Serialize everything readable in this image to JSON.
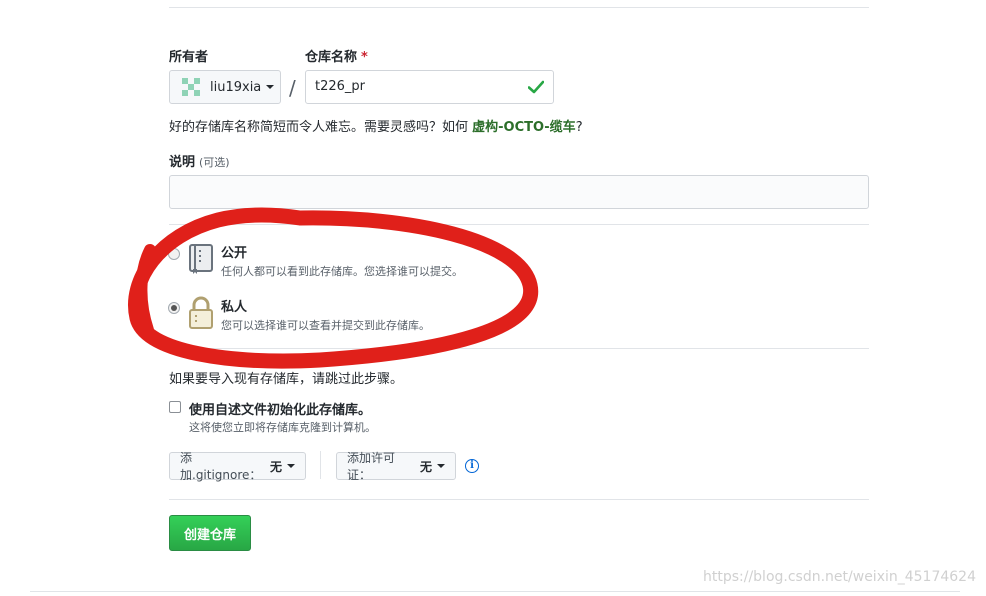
{
  "owner": {
    "label": "所有者",
    "username": "liu19xia"
  },
  "repo": {
    "label": "仓库名称",
    "required_mark": "*",
    "value": "t226_pr",
    "slash": "/"
  },
  "hint": {
    "prefix": "好的存储库名称简短而令人难忘。需要灵感吗？如何 ",
    "suggestion": "虚构-OCTO-缆车",
    "suffix": "?"
  },
  "description": {
    "label": "说明",
    "optional": "(可选)",
    "value": ""
  },
  "visibility": {
    "public": {
      "title": "公开",
      "desc": "任何人都可以看到此存储库。您选择谁可以提交。",
      "selected": false
    },
    "private": {
      "title": "私人",
      "desc": "您可以选择谁可以查看并提交到此存储库。",
      "selected": true
    }
  },
  "import_note": "如果要导入现有存储库，请跳过此步骤。",
  "initialize": {
    "label": "使用自述文件初始化此存储库。",
    "desc": "这将使您立即将存储库克隆到计算机。",
    "checked": false
  },
  "gitignore": {
    "prefix": "添加.gitignore：",
    "value": "无"
  },
  "license": {
    "prefix": "添加许可证：",
    "value": "无"
  },
  "create_button": "创建仓库",
  "watermark": "https://blog.csdn.net/weixin_45174624",
  "colors": {
    "primary_green": "#28a745",
    "annotation_red": "#e0201a",
    "link_green": "#2c6e2a",
    "info_blue": "#0366d6"
  }
}
